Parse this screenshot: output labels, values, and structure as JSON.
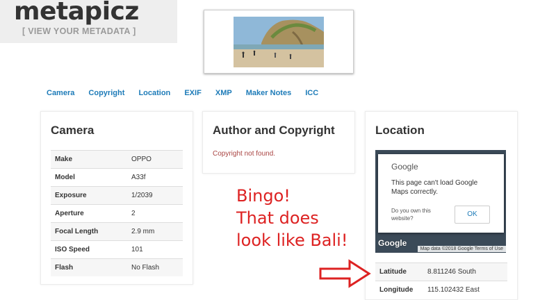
{
  "header": {
    "logo": "metapicz",
    "tagline": "[ VIEW YOUR METADATA ]"
  },
  "nav": [
    "Camera",
    "Copyright",
    "Location",
    "EXIF",
    "XMP",
    "Maker Notes",
    "ICC"
  ],
  "camera": {
    "title": "Camera",
    "rows": [
      {
        "k": "Make",
        "v": "OPPO"
      },
      {
        "k": "Model",
        "v": "A33f"
      },
      {
        "k": "Exposure",
        "v": "1/2039"
      },
      {
        "k": "Aperture",
        "v": "2"
      },
      {
        "k": "Focal Length",
        "v": "2.9 mm"
      },
      {
        "k": "ISO Speed",
        "v": "101"
      },
      {
        "k": "Flash",
        "v": "No Flash"
      }
    ]
  },
  "author": {
    "title": "Author and Copyright",
    "message": "Copyright not found."
  },
  "location": {
    "title": "Location",
    "map": {
      "brand": "Google",
      "message": "This page can't load Google Maps correctly.",
      "own": "Do you own this website?",
      "ok": "OK",
      "logo": "Google",
      "attribution": "Map data ©2018 Google    Terms of Use"
    },
    "rows": [
      {
        "k": "Latitude",
        "v": "8.811246 South"
      },
      {
        "k": "Longitude",
        "v": "115.102432 East"
      }
    ]
  },
  "annotation": {
    "line1": "Bingo!",
    "line2": "That does",
    "line3": "look like Bali!"
  }
}
